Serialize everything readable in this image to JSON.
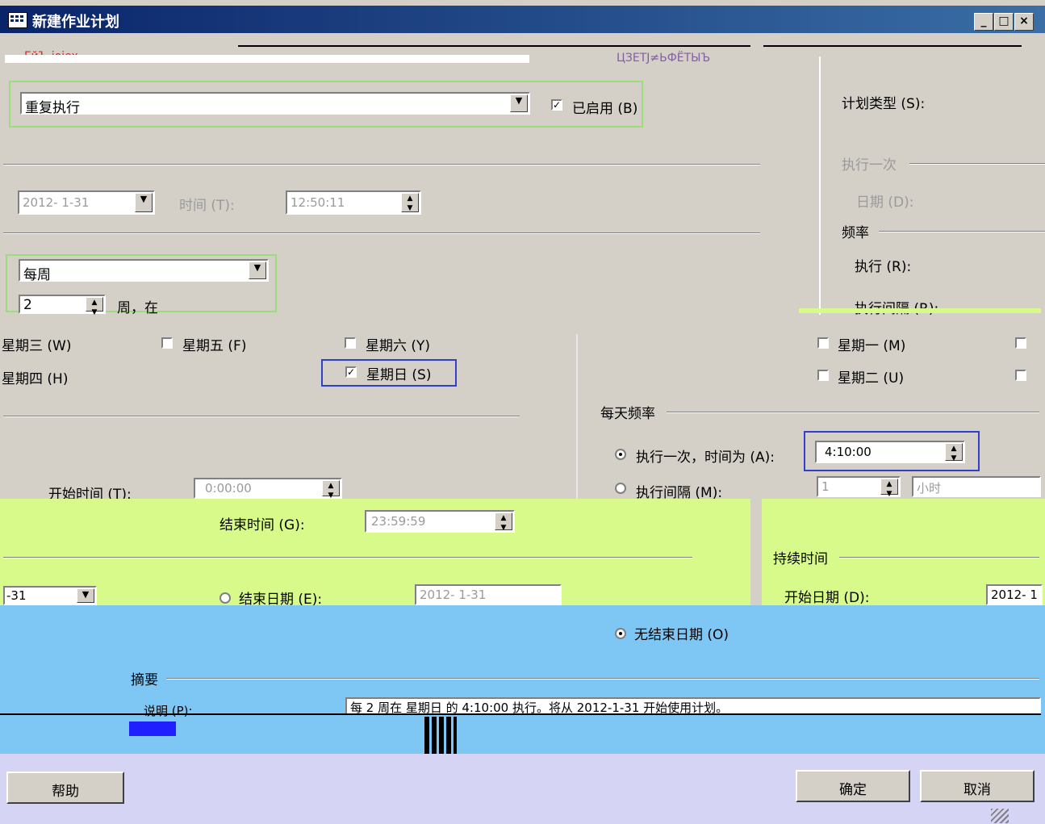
{
  "window": {
    "title": "新建作业计划",
    "buttons": {
      "minimize": "_",
      "maximize": "□",
      "close": "×"
    }
  },
  "top": {
    "name_label": "ГйЪ ioiex",
    "noise_label": "ЦЗЕТJ≠ЬФЁТЫЪ"
  },
  "schedule_type": {
    "label": "计划类型 (S):",
    "value": "重复执行",
    "enabled_label": "已启用 (B)",
    "enabled_checked": true
  },
  "once": {
    "section": "执行一次",
    "date_label": "日期 (D):",
    "date_value": "2012- 1-31",
    "time_label": "时间 (T):",
    "time_value": "12:50:11"
  },
  "frequency": {
    "section": "频率",
    "occurs_label": "执行 (R):",
    "occurs_value": "每周",
    "recurs_label": "执行间隔 (R):",
    "recurs_value": "2",
    "recurs_suffix": "周，在"
  },
  "days": {
    "monday": "星期一 (M)",
    "tuesday": "星期二 (U)",
    "wednesday": "星期三 (W)",
    "thursday": "星期四 (H)",
    "friday": "星期五 (F)",
    "saturday": "星期六 (Y)",
    "sunday": "星期日 (S)",
    "sunday_checked": true
  },
  "daily": {
    "section": "每天频率",
    "once_label": "执行一次，时间为 (A):",
    "once_value": "4:10:00",
    "interval_label": "执行间隔 (M):",
    "interval_value": "1",
    "interval_unit": "小时",
    "start_time_label": "开始时间 (T):",
    "start_time_value": "0:00:00",
    "end_time_label": "结束时间 (G):",
    "end_time_value": "23:59:59"
  },
  "duration": {
    "section": "持续时间",
    "start_label": "开始日期 (D):",
    "start_value": "2012- 1",
    "left_date": "-31",
    "end_label": "结束日期 (E):",
    "end_value": "2012- 1-31",
    "no_end_label": "无结束日期 (O)"
  },
  "summary": {
    "section": "摘要",
    "desc_label": "说明 (P):",
    "desc_value": "每 2 周在 星期日 的 4:10:00 执行。将从 2012-1-31 开始使用计划。"
  },
  "buttons": {
    "help": "帮助",
    "ok": "确定",
    "cancel": "取消"
  },
  "colors": {
    "dialog": "#d4d0c8",
    "title": "#0a246a",
    "lime": "#d8fa8a",
    "sky": "#7ec7f5",
    "lavender": "#d6d4f4"
  }
}
